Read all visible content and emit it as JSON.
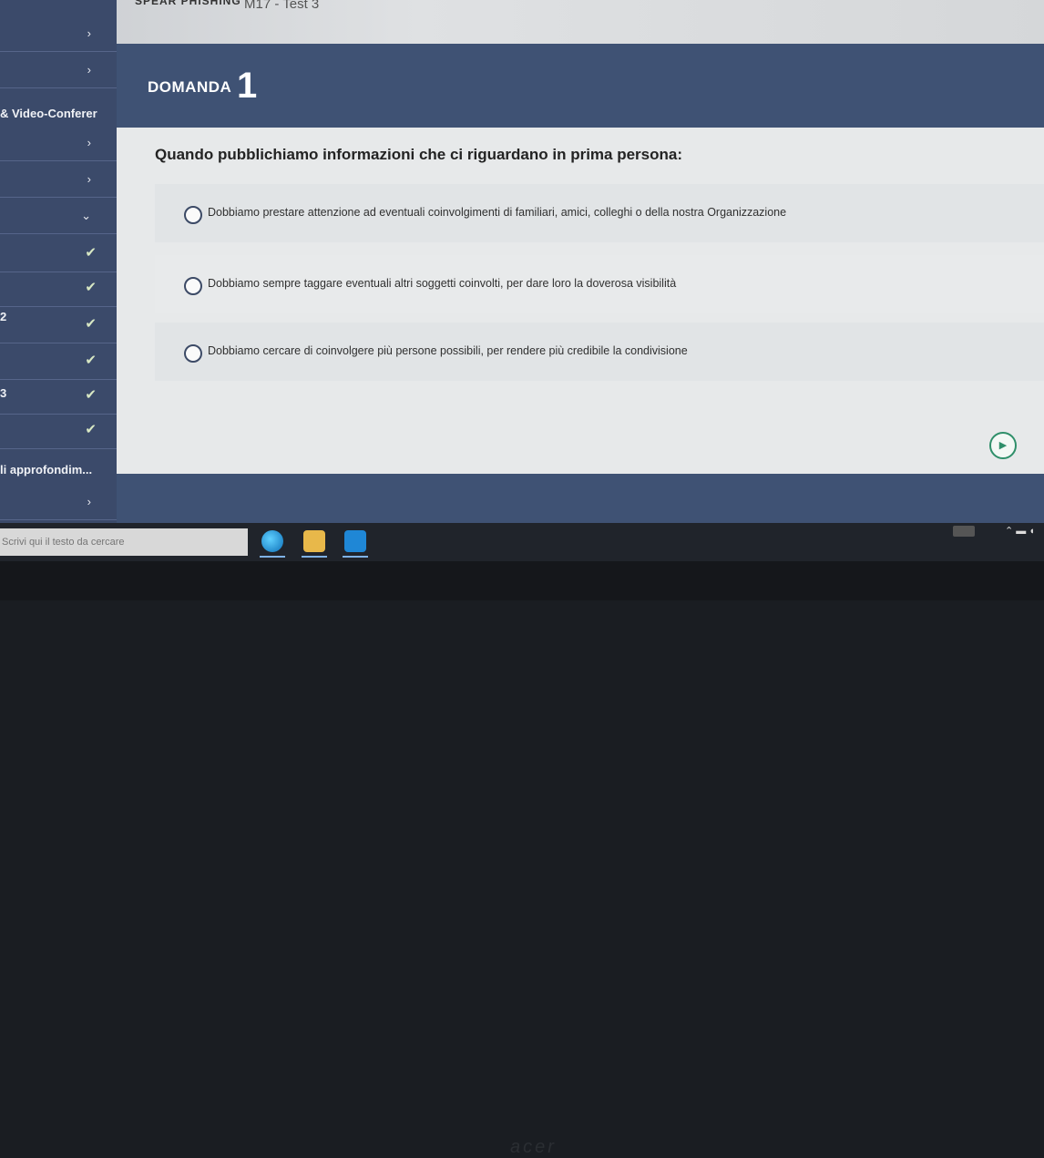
{
  "window": {
    "title": "M17 - Test 3",
    "breadcrumb": "SPEAR PHISHING"
  },
  "sidebar": {
    "labels": [
      {
        "text": "& Video-Conferer"
      },
      {
        "text": "2"
      },
      {
        "text": "3"
      },
      {
        "text": "li approfondim..."
      }
    ]
  },
  "question": {
    "header_label": "DOMANDA",
    "number": "1",
    "text": "Quando pubblichiamo informazioni che ci riguardano in prima persona:",
    "options": [
      {
        "label": "Dobbiamo prestare attenzione ad eventuali coinvolgimenti di familiari, amici, colleghi o della nostra Organizzazione"
      },
      {
        "label": "Dobbiamo sempre taggare eventuali altri soggetti coinvolti, per dare loro la doverosa visibilità"
      },
      {
        "label": "Dobbiamo cercare di coinvolgere più persone possibili, per rendere più credibile la condivisione"
      }
    ]
  },
  "taskbar": {
    "search_placeholder": "Scrivi qui il testo da cercare"
  },
  "device": {
    "brand": "acer"
  },
  "colors": {
    "sidebar": "#3b4a6a",
    "header": "#3f5274",
    "panel": "#e7e9ea",
    "accent": "#2f8f6a"
  }
}
